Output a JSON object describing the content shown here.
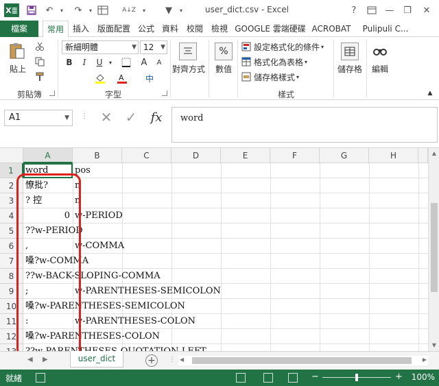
{
  "window": {
    "title": "user_dict.csv - Excel",
    "app_icon_text": "X≣",
    "help_label": "?",
    "minimize": "—",
    "restore": "❐",
    "close": "✕"
  },
  "quick_access": {
    "save": "💾",
    "undo": "↶",
    "redo": "↷",
    "sort": "A↓Z",
    "filter": "▼"
  },
  "tabs": [
    {
      "label": "檔案"
    },
    {
      "label": "常用"
    },
    {
      "label": "插入"
    },
    {
      "label": "版面配置"
    },
    {
      "label": "公式"
    },
    {
      "label": "資料"
    },
    {
      "label": "校閱"
    },
    {
      "label": "檢視"
    },
    {
      "label": "GOOGLE 雲端硬碟"
    },
    {
      "label": "ACROBAT"
    },
    {
      "label": "Pulipuli C..."
    }
  ],
  "ribbon": {
    "clipboard": {
      "paste": "貼上",
      "group": "剪貼簿"
    },
    "font": {
      "name": "新細明體",
      "size": "12",
      "bold": "B",
      "italic": "I",
      "underline": "U",
      "grow": "A",
      "shrink": "A",
      "phonetic": "中",
      "group": "字型"
    },
    "alignment": {
      "label": "對齊方式"
    },
    "number": {
      "label": "數值",
      "symbol": "%"
    },
    "styles": {
      "conditional": "設定格式化的條件",
      "table": "格式化為表格",
      "cell": "儲存格樣式",
      "group": "樣式"
    },
    "cells": {
      "label": "儲存格"
    },
    "editing": {
      "label": "編輯"
    }
  },
  "formula_bar": {
    "name_box": "A1",
    "cancel": "✕",
    "enter": "✓",
    "fx": "fx",
    "content": "word"
  },
  "grid": {
    "columns": [
      "A",
      "B",
      "C",
      "D",
      "E",
      "F",
      "G",
      "H"
    ],
    "rows": [
      "1",
      "2",
      "3",
      "4",
      "5",
      "6",
      "7",
      "8",
      "9",
      "10",
      "11",
      "12",
      "13"
    ],
    "cells": [
      {
        "a": "word",
        "b": "pos"
      },
      {
        "a": "憭批?",
        "b": "n"
      },
      {
        "a": "?  控",
        "b": "n"
      },
      {
        "a": "0",
        "b": "w-PERIOD"
      },
      {
        "a": "??w-PERIOD",
        "b": ""
      },
      {
        "a": ",",
        "b": "w-COMMA"
      },
      {
        "a": "嗓?w-COMMA",
        "b": ""
      },
      {
        "a": "??w-BACK-SLOPING-COMMA",
        "b": ""
      },
      {
        "a": ";",
        "b": "w-PARENTHESES-SEMICOLON"
      },
      {
        "a": "嗓?w-PARENTHESES-SEMICOLON",
        "b": ""
      },
      {
        "a": ":",
        "b": "w-PARENTHESES-COLON"
      },
      {
        "a": "嗓?w-PARENTHESES-COLON",
        "b": ""
      },
      {
        "a": "??w-PARENTHESES-QUOTATION-LEFT",
        "b": ""
      }
    ]
  },
  "sheets": {
    "active": "user_dict",
    "add": "+",
    "prev": "◀",
    "next": "▶"
  },
  "status": {
    "mode": "就緒",
    "zoom": "100%",
    "minus": "−",
    "plus": "+"
  },
  "colors": {
    "accent": "#217346",
    "annotation": "#e0201a"
  }
}
